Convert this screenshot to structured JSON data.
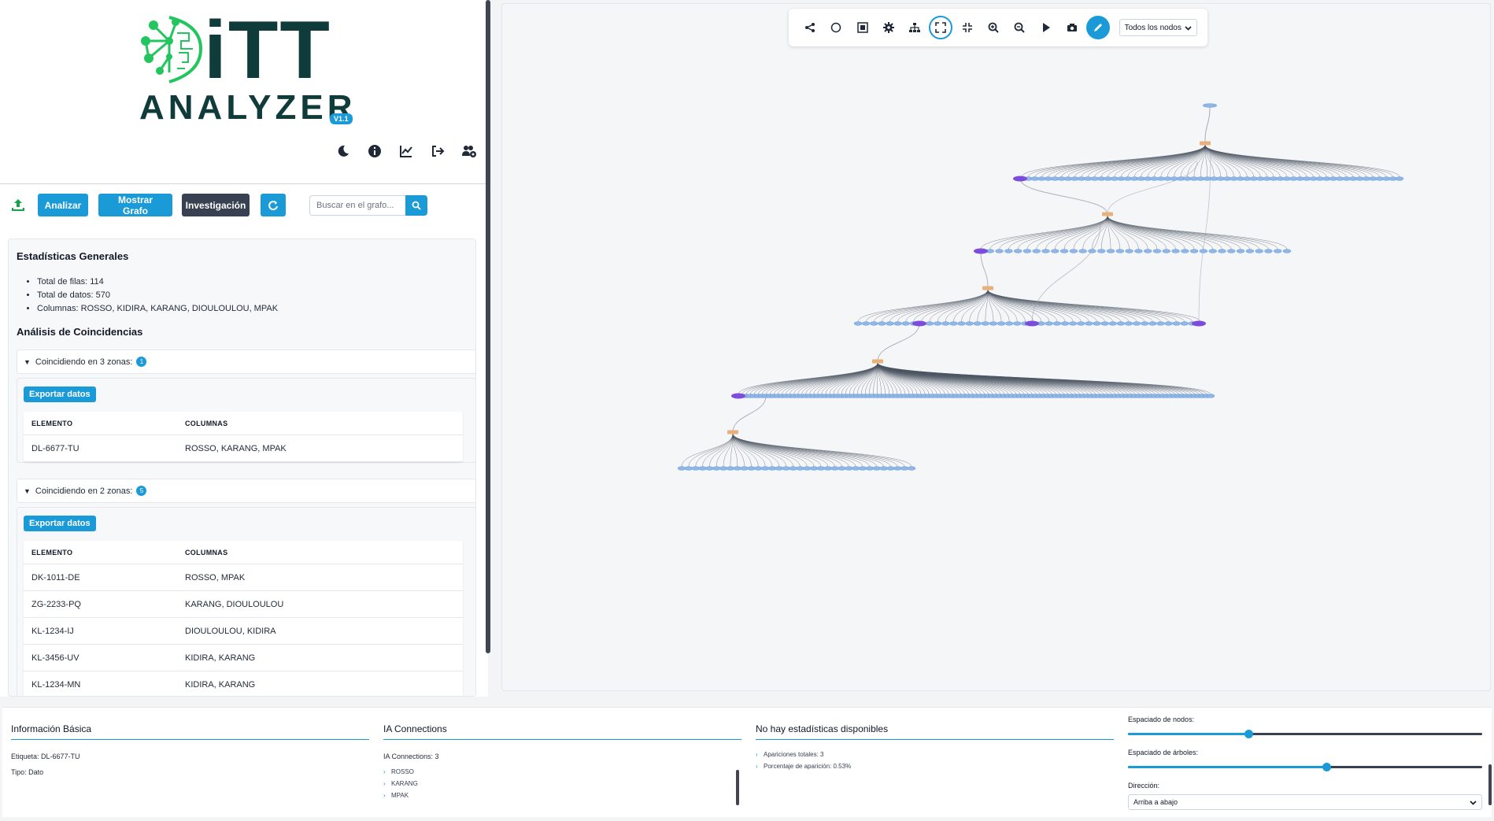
{
  "logo": {
    "line1": "iTT",
    "line2": "ANALYZER",
    "version": "V1.1"
  },
  "top_icons": [
    "moon-icon",
    "info-icon",
    "chart-line-icon",
    "sign-out-icon",
    "users-cog-icon"
  ],
  "toolbar": {
    "analyze_label": "Analizar",
    "show_graph_label": "Mostrar Grafo",
    "research_label": "Investigación",
    "search_placeholder": "Buscar en el grafo..."
  },
  "stats": {
    "title": "Estadísticas Generales",
    "rows_line": "Total de filas: 114",
    "data_line": "Total de datos: 570",
    "columns_line": "Columnas: ROSSO, KIDIRA, KARANG, DIOULOULOU, MPAK"
  },
  "coincidences": {
    "title": "Análisis de Coincidencias",
    "group3": {
      "label": "Coincidiendo en 3 zonas:",
      "count": "1",
      "export_label": "Exportar datos",
      "header_element": "ELEMENTO",
      "header_columns": "COLUMNAS",
      "rows": [
        {
          "element": "DL-6677-TU",
          "columns": "ROSSO, KARANG, MPAK"
        }
      ]
    },
    "group2": {
      "label": "Coincidiendo en 2 zonas:",
      "count": "5",
      "export_label": "Exportar datos",
      "header_element": "ELEMENTO",
      "header_columns": "COLUMNAS",
      "rows": [
        {
          "element": "DK-1011-DE",
          "columns": "ROSSO, MPAK"
        },
        {
          "element": "ZG-2233-PQ",
          "columns": "KARANG, DIOULOULOU"
        },
        {
          "element": "KL-1234-IJ",
          "columns": "DIOULOULOU, KIDIRA"
        },
        {
          "element": "KL-3456-UV",
          "columns": "KIDIRA, KARANG"
        },
        {
          "element": "KL-1234-MN",
          "columns": "KIDIRA, KARANG"
        }
      ]
    }
  },
  "graph": {
    "toolbar_icons": [
      "share-nodes-icon",
      "circle-icon",
      "image-frame-icon",
      "gear-icon",
      "sitemap-icon",
      "expand-icon",
      "compress-icon",
      "zoom-in-icon",
      "zoom-out-icon",
      "play-icon",
      "camera-icon",
      "pen-icon"
    ],
    "node_filter": "Todos los nodos",
    "colors": {
      "leaf": "#8fb6e6",
      "hub": "#e8b07a",
      "highlight": "#7c4ddb",
      "edge": "#9ca3af"
    }
  },
  "bottom": {
    "basic": {
      "title": "Información Básica",
      "label_line": "Etiqueta: DL-6677-TU",
      "type_line": "Tipo: Dato"
    },
    "ia": {
      "title": "IA Connections",
      "count_line": "IA Connections: 3",
      "items": [
        "ROSSO",
        "KARANG",
        "MPAK"
      ]
    },
    "nostats": {
      "title": "No hay estadísticas disponibles",
      "items": [
        "Apariciones totales: 3",
        "Porcentaje de aparición: 0.53%"
      ]
    },
    "controls": {
      "node_spacing_label": "Espaciado de nodos:",
      "node_spacing_value": 0.34,
      "tree_spacing_label": "Espaciado de árboles:",
      "tree_spacing_value": 0.56,
      "direction_label": "Dirección:",
      "direction_value": "Arriba a abajo"
    }
  }
}
